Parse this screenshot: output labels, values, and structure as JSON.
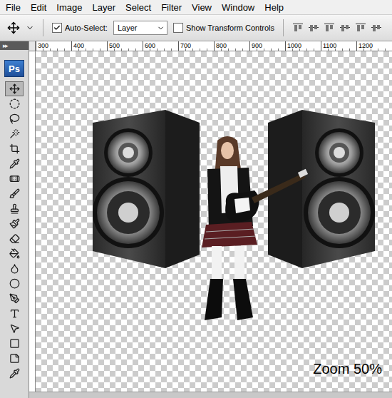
{
  "menu": [
    "File",
    "Edit",
    "Image",
    "Layer",
    "Select",
    "Filter",
    "View",
    "Window",
    "Help"
  ],
  "options_bar": {
    "auto_select": {
      "label": "Auto-Select:",
      "checked": true
    },
    "layer_select": {
      "value": "Layer"
    },
    "transform_controls": {
      "label": "Show Transform Controls",
      "checked": false
    }
  },
  "toolbox": {
    "header": "▸▸",
    "logo": "Ps",
    "tools": [
      {
        "selected": true
      },
      {
        "selected": false
      },
      {
        "selected": false
      },
      {
        "selected": false
      },
      {
        "selected": false
      },
      {
        "selected": false
      },
      {
        "selected": false
      },
      {
        "selected": false
      },
      {
        "selected": false
      },
      {
        "selected": false
      },
      {
        "selected": false
      },
      {
        "selected": false
      },
      {
        "selected": false
      },
      {
        "selected": false
      },
      {
        "selected": false
      },
      {
        "selected": false
      },
      {
        "selected": false
      },
      {
        "selected": false
      },
      {
        "selected": false
      },
      {
        "selected": false
      }
    ]
  },
  "ruler": [
    "300",
    "400",
    "500",
    "600",
    "700",
    "800",
    "900",
    "1000",
    "1100",
    "1200"
  ],
  "canvas": {
    "zoom_label": "Zoom 50%"
  }
}
